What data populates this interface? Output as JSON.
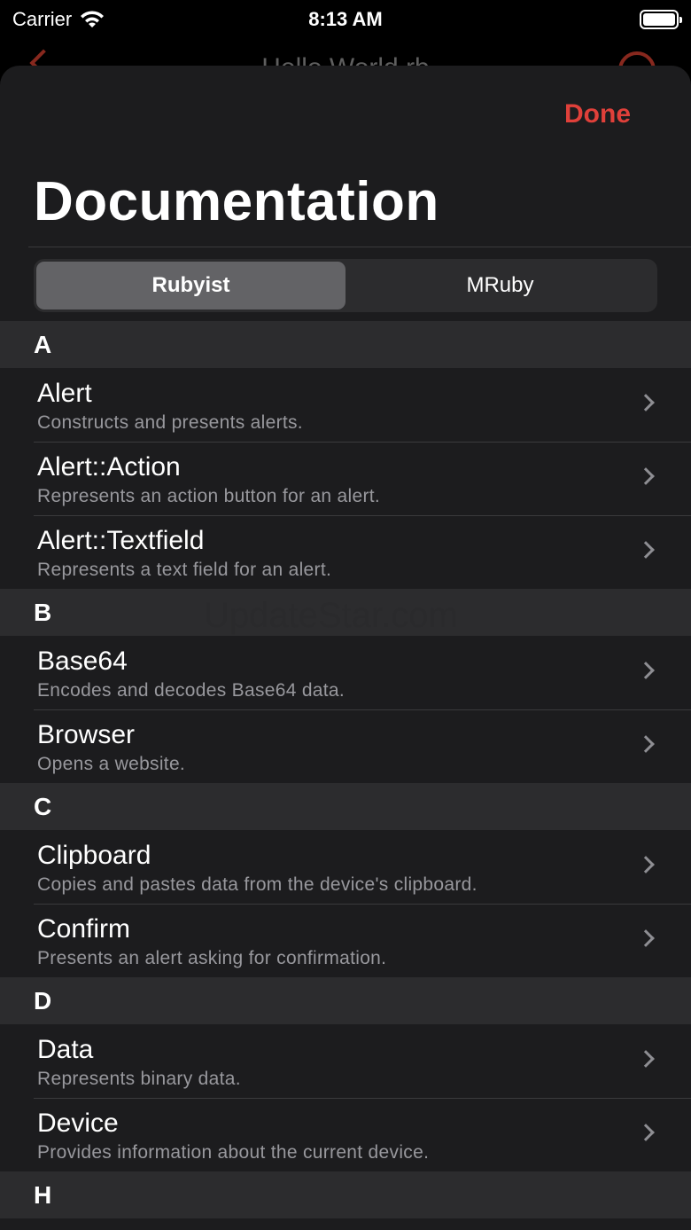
{
  "status_bar": {
    "carrier": "Carrier",
    "time": "8:13 AM"
  },
  "under_nav": {
    "title": "Hello World.rb"
  },
  "sheet": {
    "done_label": "Done",
    "title": "Documentation",
    "segments": [
      {
        "label": "Rubyist",
        "selected": true
      },
      {
        "label": "MRuby",
        "selected": false
      }
    ],
    "sections": [
      {
        "letter": "A",
        "items": [
          {
            "title": "Alert",
            "subtitle": "Constructs and presents alerts."
          },
          {
            "title": "Alert::Action",
            "subtitle": "Represents an action button for an alert."
          },
          {
            "title": "Alert::Textfield",
            "subtitle": "Represents a text field for an alert."
          }
        ]
      },
      {
        "letter": "B",
        "items": [
          {
            "title": "Base64",
            "subtitle": "Encodes and decodes Base64 data."
          },
          {
            "title": "Browser",
            "subtitle": "Opens a website."
          }
        ]
      },
      {
        "letter": "C",
        "items": [
          {
            "title": "Clipboard",
            "subtitle": "Copies and pastes data from the device's clipboard."
          },
          {
            "title": "Confirm",
            "subtitle": "Presents an alert asking for confirmation."
          }
        ]
      },
      {
        "letter": "D",
        "items": [
          {
            "title": "Data",
            "subtitle": "Represents binary data."
          },
          {
            "title": "Device",
            "subtitle": "Provides information about the current device."
          }
        ]
      },
      {
        "letter": "H",
        "items": []
      }
    ]
  },
  "watermark": "UpdateStar.com",
  "colors": {
    "accent": "#e0403a",
    "sheet_bg": "#1c1c1e",
    "section_bg": "#2c2c2e",
    "secondary_text": "#98989d"
  }
}
